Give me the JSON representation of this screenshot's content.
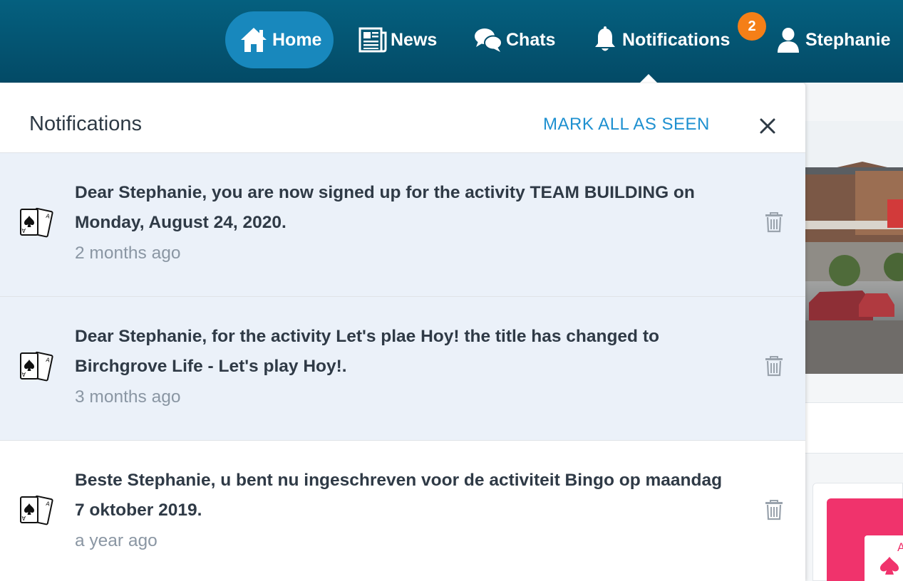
{
  "nav": {
    "home_label": "Home",
    "news_label": "News",
    "chats_label": "Chats",
    "notifications_label": "Notifications",
    "notifications_count": "2",
    "user_label": "Stephanie"
  },
  "panel": {
    "title": "Notifications",
    "mark_all_label": "MARK ALL AS SEEN"
  },
  "notifications": [
    {
      "message": "Dear Stephanie, you are now signed up for the activity TEAM BUILDING on Monday, August 24, 2020.",
      "time": "2 months ago",
      "icon": "playing-cards-icon",
      "unseen": true
    },
    {
      "message": "Dear Stephanie, for the activity Let's plae Hoy! the title has changed to Birchgrove Life - Let's play Hoy!.",
      "time": "3 months ago",
      "icon": "playing-cards-icon",
      "unseen": true
    },
    {
      "message": "Beste Stephanie, u bent nu ingeschreven voor de activiteit Bingo op maandag 7 oktober 2019.",
      "time": "a year ago",
      "icon": "playing-cards-icon",
      "unseen": false
    }
  ],
  "colors": {
    "topbar": "#034a66",
    "home_active": "#1888bd",
    "badge": "#f57f17",
    "link": "#1e90d0",
    "unseen_bg": "#ebf1f9"
  }
}
